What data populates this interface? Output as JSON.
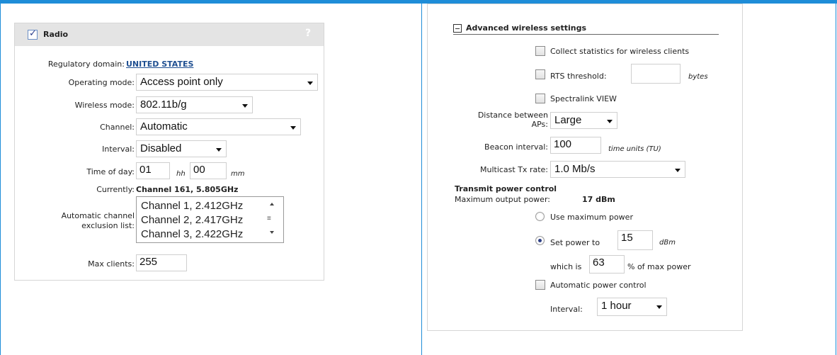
{
  "radio_panel": {
    "title": "Radio",
    "help": "?",
    "regulatory_domain": {
      "label": "Regulatory domain:",
      "value": "UNITED STATES"
    },
    "operating_mode": {
      "label": "Operating mode:",
      "value": "Access point only"
    },
    "wireless_mode": {
      "label": "Wireless mode:",
      "value": "802.11b/g"
    },
    "channel": {
      "label": "Channel:",
      "value": "Automatic"
    },
    "interval": {
      "label": "Interval:",
      "value": "Disabled"
    },
    "time_of_day": {
      "label": "Time of day:",
      "hour": "01",
      "hour_unit": "hh",
      "minute": "00",
      "minute_unit": "mm"
    },
    "currently": {
      "label": "Currently:",
      "value": "Channel 161, 5.805GHz"
    },
    "exclusion_list": {
      "label_line1": "Automatic channel",
      "label_line2": "exclusion list:",
      "options": [
        "Channel 1, 2.412GHz",
        "Channel 2, 2.417GHz",
        "Channel 3, 2.422GHz"
      ]
    },
    "max_clients": {
      "label": "Max clients:",
      "value": "255"
    }
  },
  "advanced_panel": {
    "title": "Advanced wireless settings",
    "collect_stats": {
      "label": "Collect statistics for wireless clients",
      "checked": false
    },
    "rts_threshold": {
      "label": "RTS threshold:",
      "value": "",
      "unit": "bytes",
      "checked": false
    },
    "spectralink": {
      "label": "Spectralink VIEW",
      "checked": false
    },
    "distance": {
      "label_line1": "Distance between",
      "label_line2": "APs:",
      "value": "Large"
    },
    "beacon_interval": {
      "label": "Beacon interval:",
      "value": "100",
      "unit": "time units (TU)"
    },
    "multicast_rate": {
      "label": "Multicast Tx rate:",
      "value": "1.0 Mb/s"
    },
    "tx_power": {
      "heading": "Transmit power control",
      "max_output_label": "Maximum output power:",
      "max_output_value": "17 dBm",
      "use_max": "Use maximum power",
      "set_power_label": "Set power to",
      "set_power_value": "15",
      "set_power_unit": "dBm",
      "which_is_label": "which is",
      "which_is_value": "63",
      "which_is_unit": "% of max power",
      "auto_power": "Automatic power control",
      "auto_interval_label": "Interval:",
      "auto_interval_value": "1 hour"
    }
  },
  "colors": {
    "accent": "#1e8dd8",
    "link": "#1f4f91",
    "panel_header": "#e4e4e4"
  }
}
